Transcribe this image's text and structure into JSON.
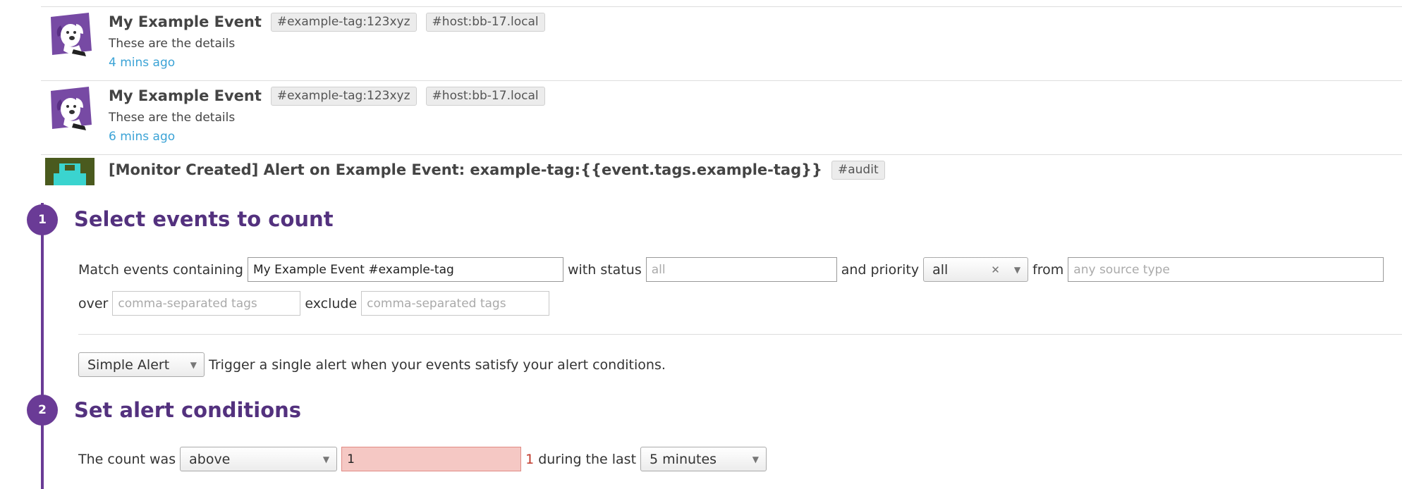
{
  "events": [
    {
      "title": "My Example Event",
      "tags": [
        "#example-tag:123xyz",
        "#host:bb-17.local"
      ],
      "details": "These are the details",
      "time": "4 mins ago",
      "avatar_icon": "datadog-dog-icon"
    },
    {
      "title": "My Example Event",
      "tags": [
        "#example-tag:123xyz",
        "#host:bb-17.local"
      ],
      "details": "These are the details",
      "time": "6 mins ago",
      "avatar_icon": "datadog-dog-icon"
    },
    {
      "title": "[Monitor Created] Alert on Example Event: example-tag:{{event.tags.example-tag}}",
      "tags": [
        "#audit"
      ],
      "avatar_icon": "monitor-avatar-icon"
    }
  ],
  "step1": {
    "number": "1",
    "title": "Select events to count",
    "match_label": "Match events containing",
    "match_value": "My Example Event #example-tag",
    "status_label": "with status",
    "status_placeholder": "all",
    "priority_label": "and priority",
    "priority_value": "all",
    "from_label": "from",
    "source_placeholder": "any source type",
    "over_label": "over",
    "over_placeholder": "comma-separated tags",
    "exclude_label": "exclude",
    "exclude_placeholder": "comma-separated tags",
    "alert_type_value": "Simple Alert",
    "alert_type_description": "Trigger a single alert when your events satisfy your alert conditions."
  },
  "step2": {
    "number": "2",
    "title": "Set alert conditions",
    "count_label": "The count was",
    "comparison_value": "above",
    "threshold_value": "1",
    "threshold_echo": "1",
    "during_label": "during the last",
    "timeframe_value": "5 minutes"
  },
  "colors": {
    "accent_purple": "#6a3b96",
    "title_purple": "#53317e",
    "link_blue": "#3ba3d6",
    "error_bg": "#f5c8c4"
  }
}
